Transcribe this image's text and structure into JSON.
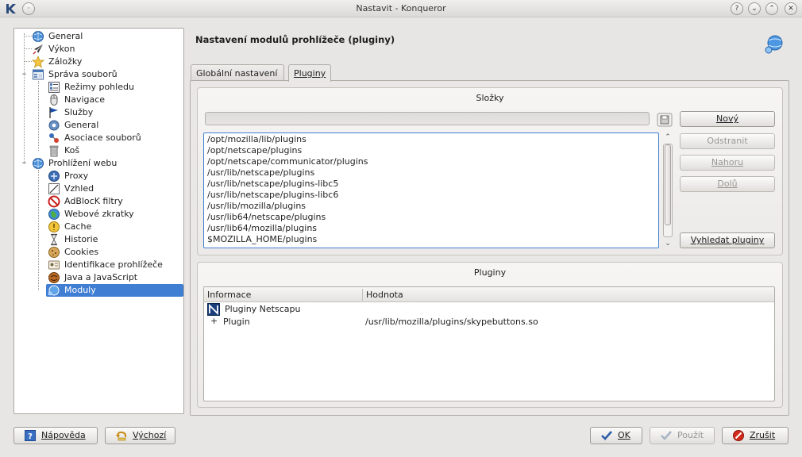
{
  "window": {
    "title": "Nastavit - Konqueror",
    "buttons": [
      "?",
      "⌄",
      "⌃",
      "✕"
    ]
  },
  "sidebar": {
    "items": [
      {
        "label": "General",
        "icon": "globe-icon"
      },
      {
        "label": "Výkon",
        "icon": "rocket-icon"
      },
      {
        "label": "Záložky",
        "icon": "star-icon"
      },
      {
        "label": "Správa souborů",
        "icon": "file-manager-icon"
      },
      {
        "label": "Režimy pohledu",
        "icon": "view-modes-icon"
      },
      {
        "label": "Navigace",
        "icon": "mouse-icon"
      },
      {
        "label": "Služby",
        "icon": "flag-icon"
      },
      {
        "label": "General",
        "icon": "gear-icon"
      },
      {
        "label": "Asociace souborů",
        "icon": "file-association-icon"
      },
      {
        "label": "Koš",
        "icon": "trash-icon"
      },
      {
        "label": "Prohlížení webu",
        "icon": "globe-icon"
      },
      {
        "label": "Proxy",
        "icon": "proxy-icon"
      },
      {
        "label": "Vzhled",
        "icon": "appearance-icon"
      },
      {
        "label": "AdBlocK filtry",
        "icon": "no-entry-icon"
      },
      {
        "label": "Webové zkratky",
        "icon": "web-shortcuts-icon"
      },
      {
        "label": "Cache",
        "icon": "cache-icon"
      },
      {
        "label": "Historie",
        "icon": "hourglass-icon"
      },
      {
        "label": "Cookies",
        "icon": "cookie-icon"
      },
      {
        "label": "Identifikace prohlížeče",
        "icon": "identity-icon"
      },
      {
        "label": "Java a JavaScript",
        "icon": "java-icon"
      },
      {
        "label": "Moduly",
        "icon": "plugin-icon"
      }
    ],
    "selected": "Moduly"
  },
  "page": {
    "title": "Nastavení modulů prohlížeče (pluginy)"
  },
  "tabs": [
    {
      "label": "Globální nastavení",
      "active": false
    },
    {
      "label": "Pluginy",
      "active": true
    }
  ],
  "folders": {
    "title": "Složky",
    "path_value": "",
    "list": [
      "/opt/mozilla/lib/plugins",
      "/opt/netscape/plugins",
      "/opt/netscape/communicator/plugins",
      "/usr/lib/netscape/plugins",
      "/usr/lib/netscape/plugins-libc5",
      "/usr/lib/netscape/plugins-libc6",
      "/usr/lib/mozilla/plugins",
      "/usr/lib64/netscape/plugins",
      "/usr/lib64/mozilla/plugins",
      "$MOZILLA_HOME/plugins"
    ],
    "buttons": {
      "new": "Nový",
      "remove": "Odstranit",
      "up": "Nahoru",
      "down": "Dolů",
      "scan": "Vyhledat pluginy"
    }
  },
  "plugins": {
    "title": "Pluginy",
    "columns": [
      "Informace",
      "Hodnota"
    ],
    "group_label": "Pluginy Netscapu",
    "rows": [
      {
        "expander": "+",
        "name": "Plugin",
        "value": "/usr/lib/mozilla/plugins/skypebuttons.so"
      }
    ]
  },
  "bottom_buttons": {
    "help": "Nápověda",
    "defaults": "Výchozí",
    "ok": "OK",
    "apply": "Použít",
    "cancel": "Zrušit"
  }
}
